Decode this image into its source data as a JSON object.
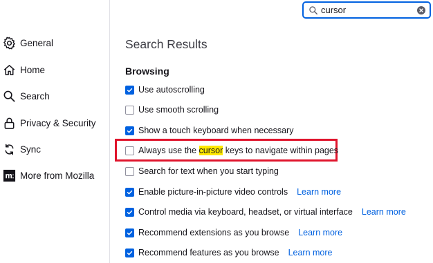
{
  "search": {
    "value": "cursor"
  },
  "sidebar": {
    "items": [
      {
        "label": "General",
        "icon": "gear-icon"
      },
      {
        "label": "Home",
        "icon": "home-icon"
      },
      {
        "label": "Search",
        "icon": "search-icon"
      },
      {
        "label": "Privacy & Security",
        "icon": "lock-icon"
      },
      {
        "label": "Sync",
        "icon": "sync-icon"
      },
      {
        "label": "More from Mozilla",
        "icon": "mozilla-icon"
      }
    ]
  },
  "main": {
    "heading": "Search Results",
    "section_title": "Browsing",
    "options": [
      {
        "label": "Use autoscrolling",
        "checked": true
      },
      {
        "label": "Use smooth scrolling",
        "checked": false
      },
      {
        "label": "Show a touch keyboard when necessary",
        "checked": true
      },
      {
        "label_before": "Always use the ",
        "label_highlight": "cursor",
        "label_after": " keys to navigate within pages",
        "checked": false
      },
      {
        "label": "Search for text when you start typing",
        "checked": false
      },
      {
        "label": "Enable picture-in-picture video controls",
        "checked": true,
        "link": "Learn more"
      },
      {
        "label": "Control media via keyboard, headset, or virtual interface",
        "checked": true,
        "link": "Learn more"
      },
      {
        "label": "Recommend extensions as you browse",
        "checked": true,
        "link": "Learn more"
      },
      {
        "label": "Recommend features as you browse",
        "checked": true,
        "link": "Learn more"
      }
    ]
  },
  "colors": {
    "accent": "#0061e0",
    "highlight": "#ffe900",
    "annotation": "#e0142c"
  }
}
